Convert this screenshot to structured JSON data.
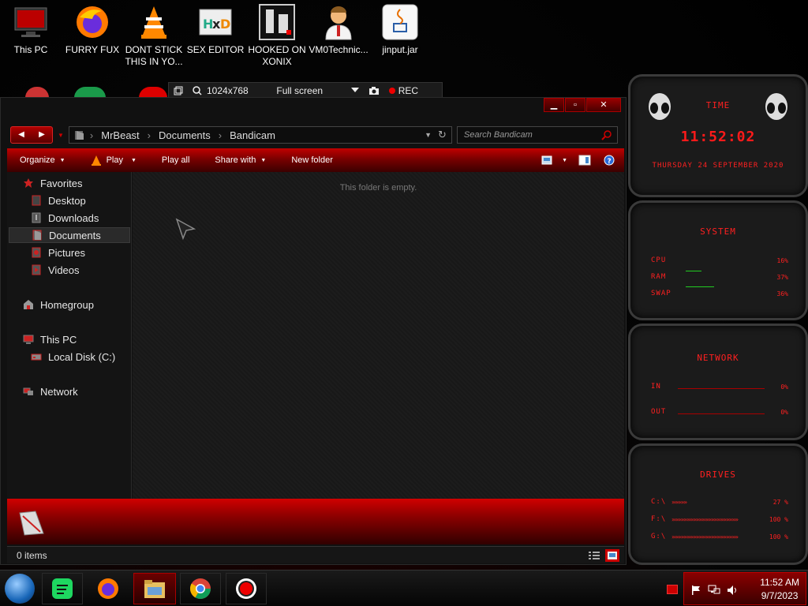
{
  "desktop": {
    "icons": [
      {
        "label": "This PC",
        "icon": "monitor-icon"
      },
      {
        "label": "FURRY FUX",
        "icon": "firefox-icon"
      },
      {
        "label": "DONT STICK THIS IN YO...",
        "icon": "vlc-icon"
      },
      {
        "label": "SEX EDITOR",
        "icon": "hxd-icon"
      },
      {
        "label": "HOOKED ON XONIX",
        "icon": "xonix-icon"
      },
      {
        "label": "VM0Technic...",
        "icon": "doctor-icon"
      },
      {
        "label": "jinput.jar",
        "icon": "java-icon"
      }
    ]
  },
  "bandicam": {
    "resolution": "1024x768",
    "mode": "Full screen",
    "rec_label": "REC"
  },
  "explorer": {
    "breadcrumbs": [
      "MrBeast",
      "Documents",
      "Bandicam"
    ],
    "search_placeholder": "Search Bandicam",
    "toolbar": {
      "organize": "Organize",
      "play": "Play",
      "play_all": "Play all",
      "share_with": "Share with",
      "new_folder": "New folder"
    },
    "nav": {
      "favorites": "Favorites",
      "desktop": "Desktop",
      "downloads": "Downloads",
      "documents": "Documents",
      "pictures": "Pictures",
      "videos": "Videos",
      "homegroup": "Homegroup",
      "this_pc": "This PC",
      "local_disk": "Local Disk (C:)",
      "network": "Network"
    },
    "empty_message": "This folder is empty.",
    "status": "0 items"
  },
  "gadgets": {
    "time": {
      "title": "TIME",
      "clock": "11:52:02",
      "date": "THURSDAY 24 SEPTEMBER 2020"
    },
    "system": {
      "title": "SYSTEM",
      "cpu_label": "CPU",
      "cpu_value": "16%",
      "ram_label": "RAM",
      "ram_value": "37%",
      "swap_label": "SWAP",
      "swap_value": "36%"
    },
    "network": {
      "title": "NETWORK",
      "in_label": "IN",
      "in_value": "0%",
      "out_label": "OUT",
      "out_value": "0%"
    },
    "drives": {
      "title": "DRIVES",
      "c_label": "C:\\",
      "c_value": "27 %",
      "f_label": "F:\\",
      "f_value": "100 %",
      "g_label": "G:\\",
      "g_value": "100 %"
    }
  },
  "taskbar": {
    "time": "11:52 AM",
    "date": "9/7/2023"
  },
  "colors": {
    "accent": "#cc0000",
    "gadget_text": "#ff2020"
  }
}
